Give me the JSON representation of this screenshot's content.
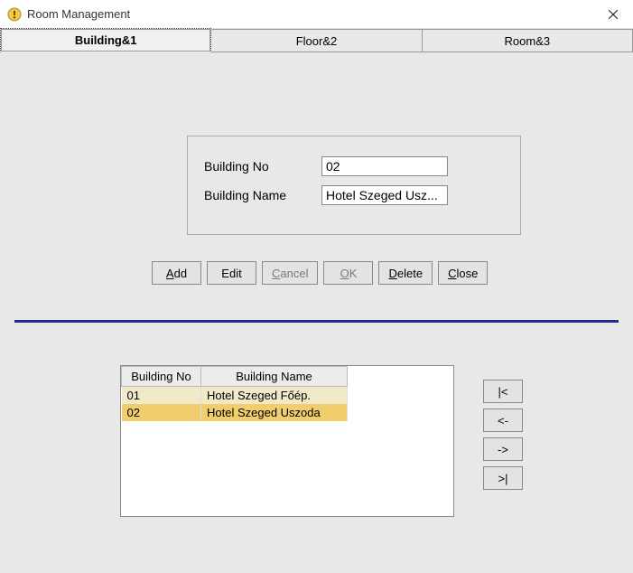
{
  "window": {
    "title": "Room Management"
  },
  "tabs": [
    {
      "label": "Building&1",
      "active": true
    },
    {
      "label": "Floor&2",
      "active": false
    },
    {
      "label": "Room&3",
      "active": false
    }
  ],
  "form": {
    "building_no_label": "Building No",
    "building_no_value": "02",
    "building_name_label": "Building Name",
    "building_name_value": "Hotel Szeged Usz..."
  },
  "buttons": {
    "add": "Add",
    "add_ul": "A",
    "add_rest": "dd",
    "edit": "Edit",
    "cancel": "Cancel",
    "cancel_ul": "C",
    "cancel_rest": "ancel",
    "ok_ul": "O",
    "ok_rest": "K",
    "delete_ul": "D",
    "delete_rest": "elete",
    "close_ul": "C",
    "close_rest": "lose"
  },
  "table": {
    "headers": {
      "col1": "Building No",
      "col2": "Building Name"
    },
    "rows": [
      {
        "no": "01",
        "name": "Hotel Szeged Főép.",
        "state": "alt"
      },
      {
        "no": "02",
        "name": "Hotel Szeged Uszoda",
        "state": "sel"
      }
    ]
  },
  "nav": {
    "first": "|<",
    "prev": "<-",
    "next": "->",
    "last": ">|"
  }
}
